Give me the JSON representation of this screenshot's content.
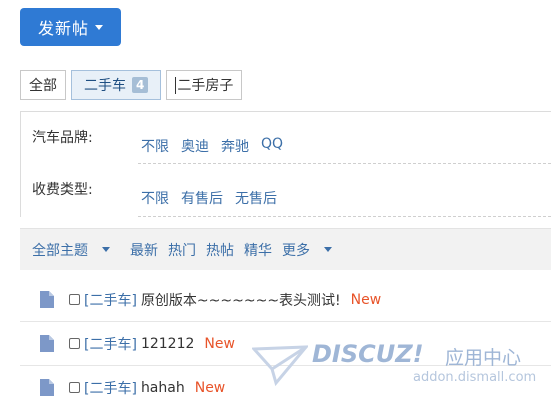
{
  "post_button": {
    "label": "发新帖"
  },
  "tabs": [
    {
      "label": "全部"
    },
    {
      "label": "二手车",
      "count": "4"
    },
    {
      "label": "二手房子"
    }
  ],
  "filters": {
    "brand": {
      "label": "汽车品牌:",
      "options": [
        "不限",
        "奥迪",
        "奔驰",
        "QQ"
      ]
    },
    "fee": {
      "label": "收费类型:",
      "options": [
        "不限",
        "有售后",
        "无售后"
      ]
    }
  },
  "thread_bar": {
    "all_topics": "全部主题",
    "latest": "最新",
    "hot": "热门",
    "hot_posts": "热帖",
    "digest": "精华",
    "more": "更多"
  },
  "threads": [
    {
      "category": "[二手车]",
      "title": "原创版本~~~~~~~表头测试!",
      "badge": "New"
    },
    {
      "category": "[二手车]",
      "title": "121212",
      "badge": "New"
    },
    {
      "category": "[二手车]",
      "title": "hahah",
      "badge": "New"
    }
  ],
  "watermark": {
    "brand": "DISCUZ!",
    "cn": "应用中心",
    "url": "addon.dismall.com"
  },
  "colors": {
    "accent": "#2f7ad4",
    "link": "#3c6fa8",
    "new_badge": "#e8542a"
  }
}
